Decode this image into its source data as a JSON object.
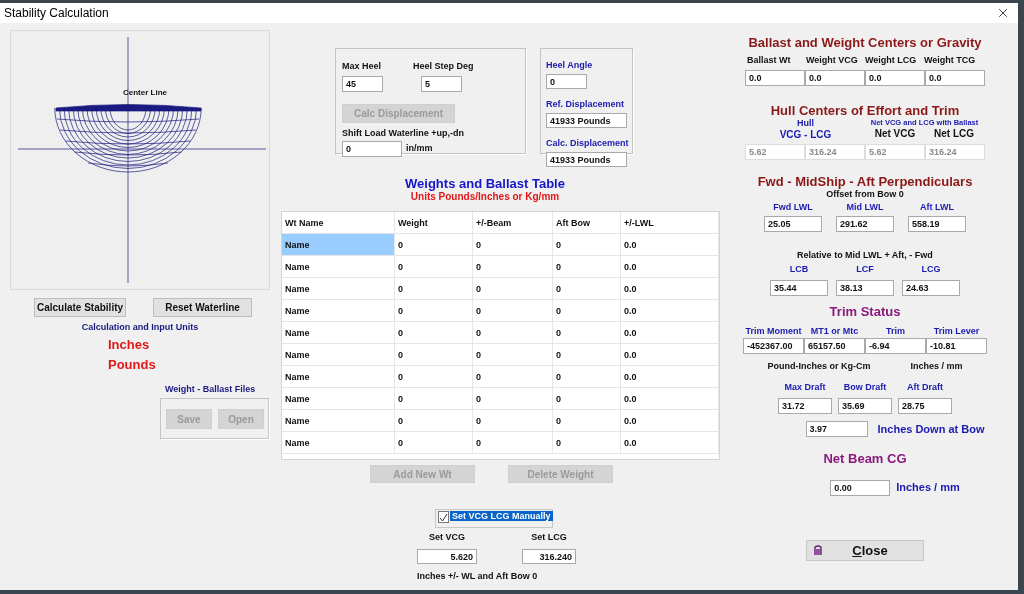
{
  "window": {
    "title": "Stability Calculation"
  },
  "hull_view": {
    "label": "Center Line"
  },
  "left_buttons": [
    {
      "label": "Calculate Stability",
      "disabled": false
    },
    {
      "label": "Reset Waterline",
      "disabled": false
    }
  ],
  "units": {
    "title": "Calculation and Input Units",
    "values": [
      "Inches",
      "Pounds"
    ]
  },
  "files": {
    "title": "Weight - Ballast Files",
    "buttons": [
      {
        "label": "Save",
        "disabled": true
      },
      {
        "label": "Open",
        "disabled": true
      }
    ]
  },
  "heel_group": {
    "fields": [
      {
        "label": "Max Heel",
        "value": "45"
      },
      {
        "label": "Heel Step Deg",
        "value": "5"
      }
    ],
    "calc_button": {
      "label": "Calc Displacement",
      "disabled": true
    },
    "shift": {
      "label": "Shift Load Waterline +up,-dn",
      "value": "0",
      "unit": "in/mm"
    }
  },
  "displacement_group": {
    "fields": [
      {
        "label": "Heel Angle",
        "value": "0"
      },
      {
        "label": "Ref. Displacement",
        "value": "41933 Pounds"
      },
      {
        "label": "Calc. Displacement",
        "value": "41933 Pounds"
      }
    ]
  },
  "weights_table": {
    "title": "Weights and Ballast Table",
    "subtitle": "Units Pounds/Inches or Kg/mm",
    "columns": [
      "Wt Name",
      "Weight",
      "+/-Beam",
      "Aft Bow",
      "+/-LWL"
    ],
    "rows": [
      {
        "selected": true,
        "cells": [
          "Name",
          "0",
          "0",
          "0",
          "0.0"
        ]
      },
      {
        "selected": false,
        "cells": [
          "Name",
          "0",
          "0",
          "0",
          "0.0"
        ]
      },
      {
        "selected": false,
        "cells": [
          "Name",
          "0",
          "0",
          "0",
          "0.0"
        ]
      },
      {
        "selected": false,
        "cells": [
          "Name",
          "0",
          "0",
          "0",
          "0.0"
        ]
      },
      {
        "selected": false,
        "cells": [
          "Name",
          "0",
          "0",
          "0",
          "0.0"
        ]
      },
      {
        "selected": false,
        "cells": [
          "Name",
          "0",
          "0",
          "0",
          "0.0"
        ]
      },
      {
        "selected": false,
        "cells": [
          "Name",
          "0",
          "0",
          "0",
          "0.0"
        ]
      },
      {
        "selected": false,
        "cells": [
          "Name",
          "0",
          "0",
          "0",
          "0.0"
        ]
      },
      {
        "selected": false,
        "cells": [
          "Name",
          "0",
          "0",
          "0",
          "0.0"
        ]
      },
      {
        "selected": false,
        "cells": [
          "Name",
          "0",
          "0",
          "0",
          "0.0"
        ]
      }
    ]
  },
  "table_buttons": [
    {
      "label": "Add New Wt",
      "disabled": true
    },
    {
      "label": "Delete Weight",
      "disabled": true
    }
  ],
  "manual": {
    "label": "Set VCG LCG Manually",
    "checked": true,
    "fields": [
      {
        "label": "Set VCG",
        "value": "5.620"
      },
      {
        "label": "Set LCG",
        "value": "316.240"
      }
    ],
    "note": "Inches  +/- WL and Aft Bow 0"
  },
  "ballast": {
    "title": "Ballast and Weight Centers or Gravity",
    "columns": [
      "Ballast Wt",
      "Weight VCG",
      "Weight LCG",
      "Weight TCG"
    ],
    "values": [
      "0.0",
      "0.0",
      "0.0",
      "0.0"
    ]
  },
  "hull_centers": {
    "title": "Hull Centers of Effort and Trim",
    "hull_caption": "Hull",
    "hull_labels": "VCG  -  LCG",
    "net_caption": "Net VCG and LCG with Ballast",
    "net_labels": [
      "Net VCG",
      "Net LCG"
    ],
    "fields": [
      {
        "value": "5.62",
        "disabled": true
      },
      {
        "value": "316.24",
        "disabled": true
      },
      {
        "value": "5.62",
        "disabled": true
      },
      {
        "value": "316.24",
        "disabled": true
      }
    ]
  },
  "perpendiculars": {
    "title": "Fwd -  MidShip -  Aft Perpendiculars",
    "subtitle": "Offset from Bow 0",
    "fields": [
      {
        "label": "Fwd  LWL",
        "value": "25.05"
      },
      {
        "label": "Mid LWL",
        "value": "291.62"
      },
      {
        "label": "Aft LWL",
        "value": "558.19"
      }
    ],
    "note": "Relative to Mid LWL + Aft, - Fwd",
    "centers": [
      {
        "label": "LCB",
        "value": "35.44"
      },
      {
        "label": "LCF",
        "value": "38.13"
      },
      {
        "label": "LCG",
        "value": "24.63"
      }
    ]
  },
  "trim": {
    "title": "Trim Status",
    "fields": [
      {
        "label": "Trim Moment",
        "value": "-452367.00"
      },
      {
        "label": "MT1 or Mtc",
        "value": "65157.50"
      },
      {
        "label": "Trim",
        "value": "-6.94"
      },
      {
        "label": "Trim Lever",
        "value": "-10.81"
      }
    ],
    "units": [
      "Pound-Inches or Kg-Cm",
      "Inches / mm"
    ],
    "drafts": [
      {
        "label": "Max Draft",
        "value": "31.72"
      },
      {
        "label": "Bow Draft",
        "value": "35.69"
      },
      {
        "label": "Aft Draft",
        "value": "28.75"
      }
    ],
    "down": {
      "value": "3.97",
      "label": "Inches Down at Bow"
    }
  },
  "net_beam": {
    "title": "Net Beam CG",
    "value": "0.00",
    "unit": "Inches / mm"
  },
  "close_button": {
    "label": "Close"
  }
}
